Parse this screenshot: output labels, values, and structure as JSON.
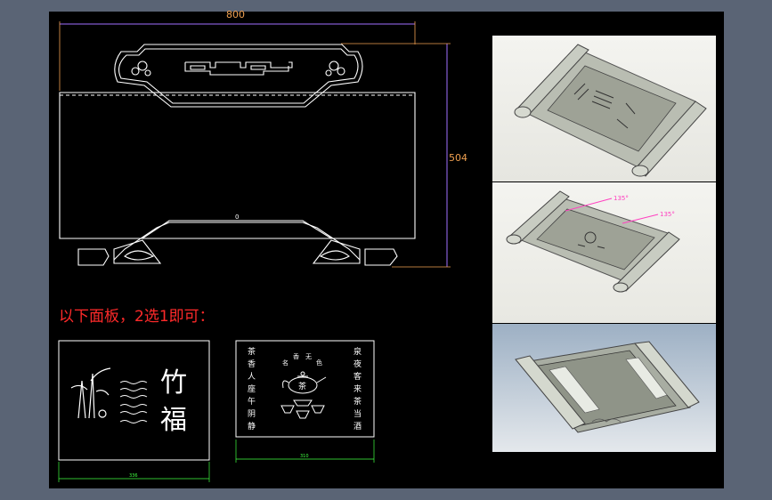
{
  "dimensions": {
    "width": "800",
    "height": "504",
    "center": "0",
    "panel_a_width": "336",
    "panel_b_width": "310"
  },
  "note": "以下面板，2选1即可：",
  "panel_a": {
    "char_1": "竹",
    "char_2": "福"
  },
  "panel_b": {
    "col_left": [
      "茶",
      "香",
      "人",
      "座",
      "午",
      "阴",
      "静"
    ],
    "col_right": [
      "泉",
      "夜",
      "客",
      "来",
      "茶",
      "当",
      "酒"
    ],
    "top_arc": [
      "名",
      "香",
      "无",
      "色"
    ],
    "center_char": "茶"
  },
  "render_2": {
    "angle_1": "135°",
    "angle_2": "135°"
  },
  "colors": {
    "background": "#5a6475",
    "drawing_bg": "#000000",
    "line": "#ffffff",
    "dim_orange": "#f0a050",
    "dim_green": "#40ff40",
    "dim_violet": "#a070ff",
    "note_red": "#ff2a2a"
  }
}
